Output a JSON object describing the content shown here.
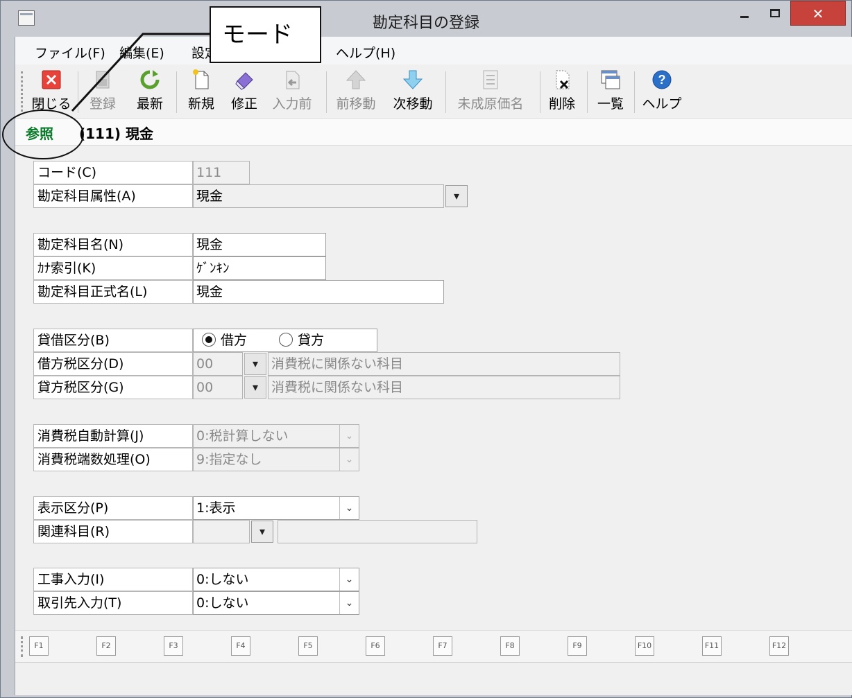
{
  "window": {
    "title": "勘定科目の登録",
    "close_glyph": "✕"
  },
  "menu": [
    "ファイル(F)",
    "編集(E)",
    "設定",
    "ヘルプ(H)"
  ],
  "toolbar": [
    {
      "label": "閉じる",
      "icon": "close-icon",
      "enabled": true
    },
    {
      "label": "登録",
      "icon": "save-icon",
      "enabled": false
    },
    {
      "label": "最新",
      "icon": "refresh-icon",
      "enabled": true
    },
    {
      "label": "新規",
      "icon": "new-doc-icon",
      "enabled": true
    },
    {
      "label": "修正",
      "icon": "eraser-icon",
      "enabled": true
    },
    {
      "label": "入力前",
      "icon": "undo-doc-icon",
      "enabled": false
    },
    {
      "label": "前移動",
      "icon": "arrow-up-icon",
      "enabled": false
    },
    {
      "label": "次移動",
      "icon": "arrow-down-icon",
      "enabled": true
    },
    {
      "label": "未成原価名",
      "icon": "list-icon",
      "enabled": false
    },
    {
      "label": "削除",
      "icon": "delete-doc-icon",
      "enabled": true
    },
    {
      "label": "一覧",
      "icon": "list-window-icon",
      "enabled": true
    },
    {
      "label": "ヘルプ",
      "icon": "help-icon",
      "enabled": true
    }
  ],
  "mode": {
    "label": "参照",
    "title": "(111) 現金"
  },
  "annotation": {
    "callout": "モード"
  },
  "form": {
    "code": {
      "label": "コード(C)",
      "value": "111"
    },
    "attribute": {
      "label": "勘定科目属性(A)",
      "value": "現金"
    },
    "name": {
      "label": "勘定科目名(N)",
      "value": "現金"
    },
    "kana": {
      "label": "ｶﾅ索引(K)",
      "value": "ｹﾞﾝｷﾝ"
    },
    "formal_name": {
      "label": "勘定科目正式名(L)",
      "value": "現金"
    },
    "debit_credit": {
      "label": "貸借区分(B)",
      "options": [
        "借方",
        "貸方"
      ],
      "selected": "借方"
    },
    "debit_tax": {
      "label": "借方税区分(D)",
      "code": "00",
      "desc": "消費税に関係ない科目"
    },
    "credit_tax": {
      "label": "貸方税区分(G)",
      "code": "00",
      "desc": "消費税に関係ない科目"
    },
    "auto_tax": {
      "label": "消費税自動計算(J)",
      "value": "0:税計算しない"
    },
    "rounding": {
      "label": "消費税端数処理(O)",
      "value": "9:指定なし"
    },
    "display": {
      "label": "表示区分(P)",
      "value": "1:表示"
    },
    "related": {
      "label": "関連科目(R)",
      "value": ""
    },
    "construction": {
      "label": "工事入力(I)",
      "value": "0:しない"
    },
    "partner": {
      "label": "取引先入力(T)",
      "value": "0:しない"
    }
  },
  "fkeys": [
    "F1",
    "F2",
    "F3",
    "F4",
    "F5",
    "F6",
    "F7",
    "F8",
    "F9",
    "F10",
    "F11",
    "F12"
  ]
}
